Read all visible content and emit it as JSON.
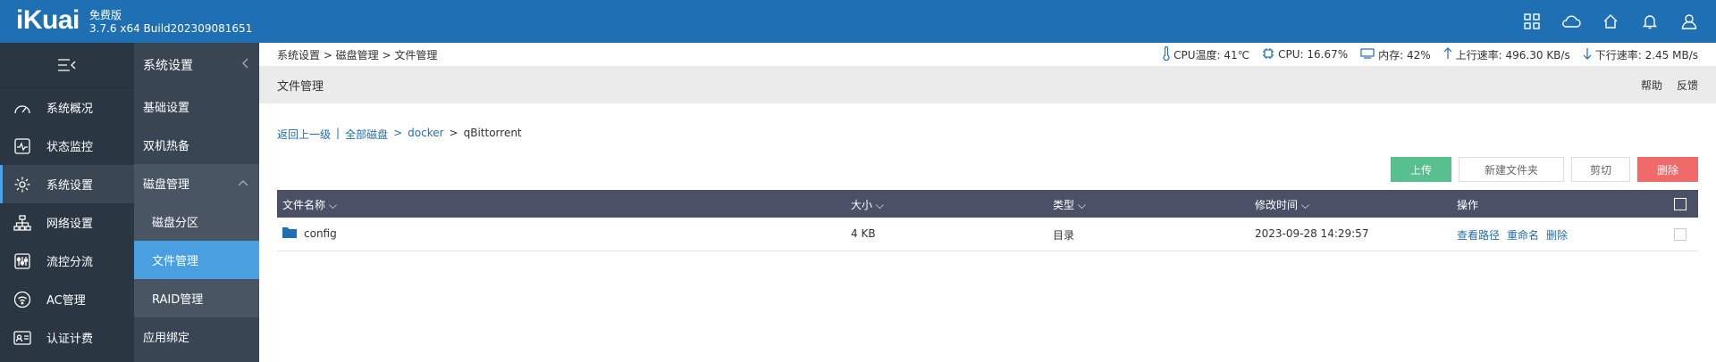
{
  "brand": {
    "logo": "iKuai",
    "edition": "免费版",
    "version": "3.7.6 x64 Build202309081651"
  },
  "top_icons": [
    "grid-icon",
    "cloud-icon",
    "home-icon",
    "bell-icon",
    "user-icon"
  ],
  "nav_primary": [
    {
      "label": "系统概况",
      "icon": "dashboard-icon"
    },
    {
      "label": "状态监控",
      "icon": "monitor-icon"
    },
    {
      "label": "系统设置",
      "icon": "gear-icon",
      "active": true
    },
    {
      "label": "网络设置",
      "icon": "network-icon"
    },
    {
      "label": "流控分流",
      "icon": "sliders-icon"
    },
    {
      "label": "AC管理",
      "icon": "wifi-icon"
    },
    {
      "label": "认证计费",
      "icon": "id-card-icon"
    }
  ],
  "nav_secondary": {
    "title": "系统设置",
    "items": [
      "基础设置",
      "双机热备",
      "磁盘管理",
      "磁盘分区",
      "文件管理",
      "RAID管理",
      "应用绑定"
    ]
  },
  "status": {
    "breadcrumb": "系统设置 > 磁盘管理 > 文件管理",
    "cpu_temp": "CPU温度: 41℃",
    "cpu": "CPU: 16.67%",
    "mem": "内存: 42%",
    "up": "上行速率: 496.30 KB/s",
    "down": "下行速率: 2.45 MB/s"
  },
  "page": {
    "title": "文件管理",
    "help": "帮助",
    "feedback": "反馈"
  },
  "path": {
    "back": "返回上一级",
    "sep": "|",
    "all": "全部磁盘",
    "gt1": ">",
    "docker": "docker",
    "gt2": ">",
    "current": "qBittorrent"
  },
  "buttons": {
    "upload": "上传",
    "new_folder": "新建文件夹",
    "cut": "剪切",
    "delete": "删除"
  },
  "table": {
    "headers": {
      "name": "文件名称",
      "size": "大小",
      "type": "类型",
      "mtime": "修改时间",
      "ops": "操作"
    },
    "rows": [
      {
        "name": "config",
        "size": "4 KB",
        "type": "目录",
        "mtime": "2023-09-28 14:29:57",
        "op1": "查看路径",
        "op2": "重命名",
        "op3": "删除"
      }
    ]
  },
  "colors": {
    "topbar": "#1e6fb3",
    "sidebar": "#2b3643",
    "selected": "#4a9fe0",
    "upload": "#58c08f",
    "delete": "#f06a6a"
  }
}
